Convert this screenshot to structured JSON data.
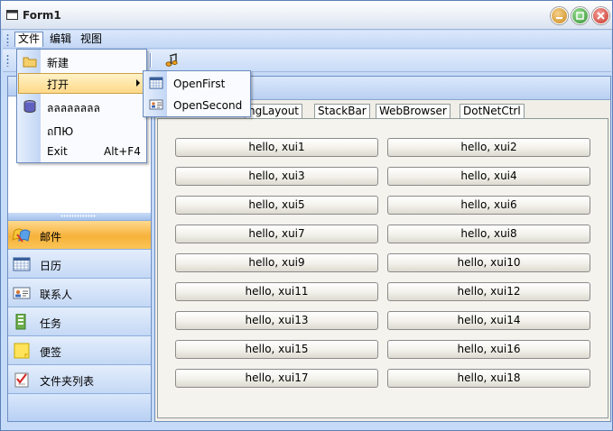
{
  "window": {
    "title": "Form1"
  },
  "menubar": {
    "items": [
      "文件",
      "编辑",
      "视图"
    ]
  },
  "file_menu": {
    "items": [
      {
        "label": "新建",
        "shortcut": "",
        "icon": "folder-icon"
      },
      {
        "label": "打开",
        "shortcut": "",
        "icon": "",
        "has_submenu": true
      },
      {
        "label": "ลลลลลลลล",
        "shortcut": "",
        "icon": "database-icon"
      },
      {
        "label": "ถПЮ",
        "shortcut": "",
        "icon": ""
      },
      {
        "label": "Exit",
        "shortcut": "Alt+F4",
        "icon": ""
      }
    ]
  },
  "open_submenu": {
    "items": [
      {
        "label": "OpenFirst",
        "icon": "calendar-icon"
      },
      {
        "label": "OpenSecond",
        "icon": "contact-card-icon"
      }
    ]
  },
  "navigation": {
    "buttons": [
      {
        "label": "邮件",
        "icon": "mail-icon",
        "selected": true
      },
      {
        "label": "日历",
        "icon": "calendar-icon",
        "selected": false
      },
      {
        "label": "联系人",
        "icon": "contacts-icon",
        "selected": false
      },
      {
        "label": "任务",
        "icon": "tasks-icon",
        "selected": false
      },
      {
        "label": "便签",
        "icon": "notes-icon",
        "selected": false
      },
      {
        "label": "文件夹列表",
        "icon": "folder-list-icon",
        "selected": false
      }
    ]
  },
  "tabs": [
    "ngLayout",
    "StackBar",
    "WebBrowser",
    "DotNetCtrl"
  ],
  "buttons": [
    "hello, xui1",
    "hello, xui2",
    "hello, xui3",
    "hello, xui4",
    "hello, xui5",
    "hello, xui6",
    "hello, xui7",
    "hello, xui8",
    "hello, xui9",
    "hello, xui10",
    "hello, xui11",
    "hello, xui12",
    "hello, xui13",
    "hello, xui14",
    "hello, xui15",
    "hello, xui16",
    "hello, xui17",
    "hello, xui18"
  ],
  "colors": {
    "accent": "#f7b23a",
    "frame": "#c6dbf8",
    "menu_highlight": "#ffd888"
  }
}
